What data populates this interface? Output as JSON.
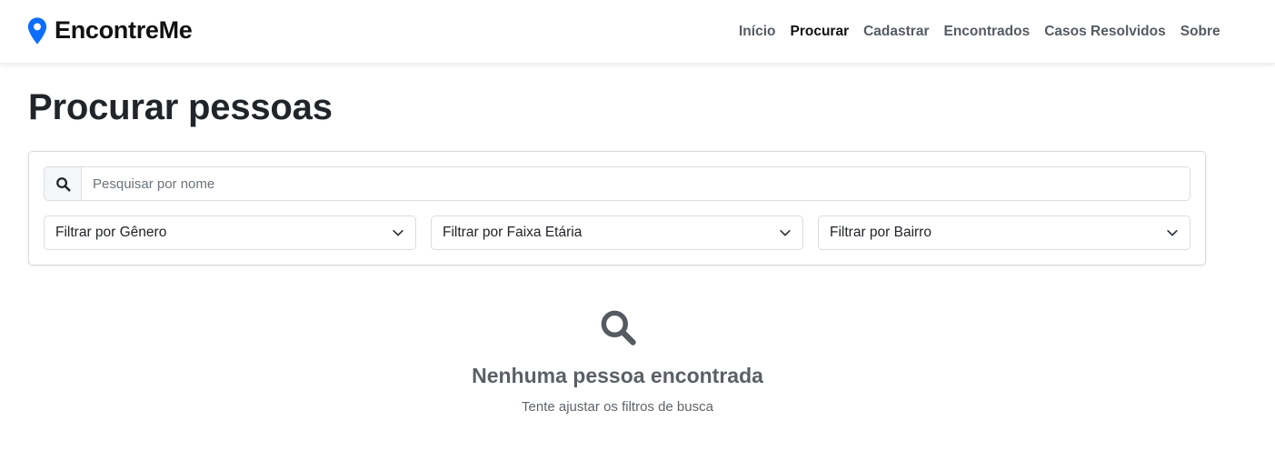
{
  "brand": {
    "name": "EncontreMe",
    "icon": "map-pin-icon",
    "accent_color": "#0d6efd"
  },
  "nav": {
    "items": [
      {
        "label": "Início",
        "active": false
      },
      {
        "label": "Procurar",
        "active": true
      },
      {
        "label": "Cadastrar",
        "active": false
      },
      {
        "label": "Encontrados",
        "active": false
      },
      {
        "label": "Casos Resolvidos",
        "active": false
      },
      {
        "label": "Sobre",
        "active": false
      }
    ]
  },
  "page": {
    "title": "Procurar pessoas"
  },
  "search": {
    "icon": "search-icon",
    "placeholder": "Pesquisar por nome",
    "value": ""
  },
  "filters": {
    "gender": {
      "label": "Filtrar por Gênero"
    },
    "age_range": {
      "label": "Filtrar por Faixa Etária"
    },
    "neighborhood": {
      "label": "Filtrar por Bairro"
    }
  },
  "empty_state": {
    "icon": "search-icon",
    "title": "Nenhuma pessoa encontrada",
    "subtitle": "Tente ajustar os filtros de busca"
  }
}
